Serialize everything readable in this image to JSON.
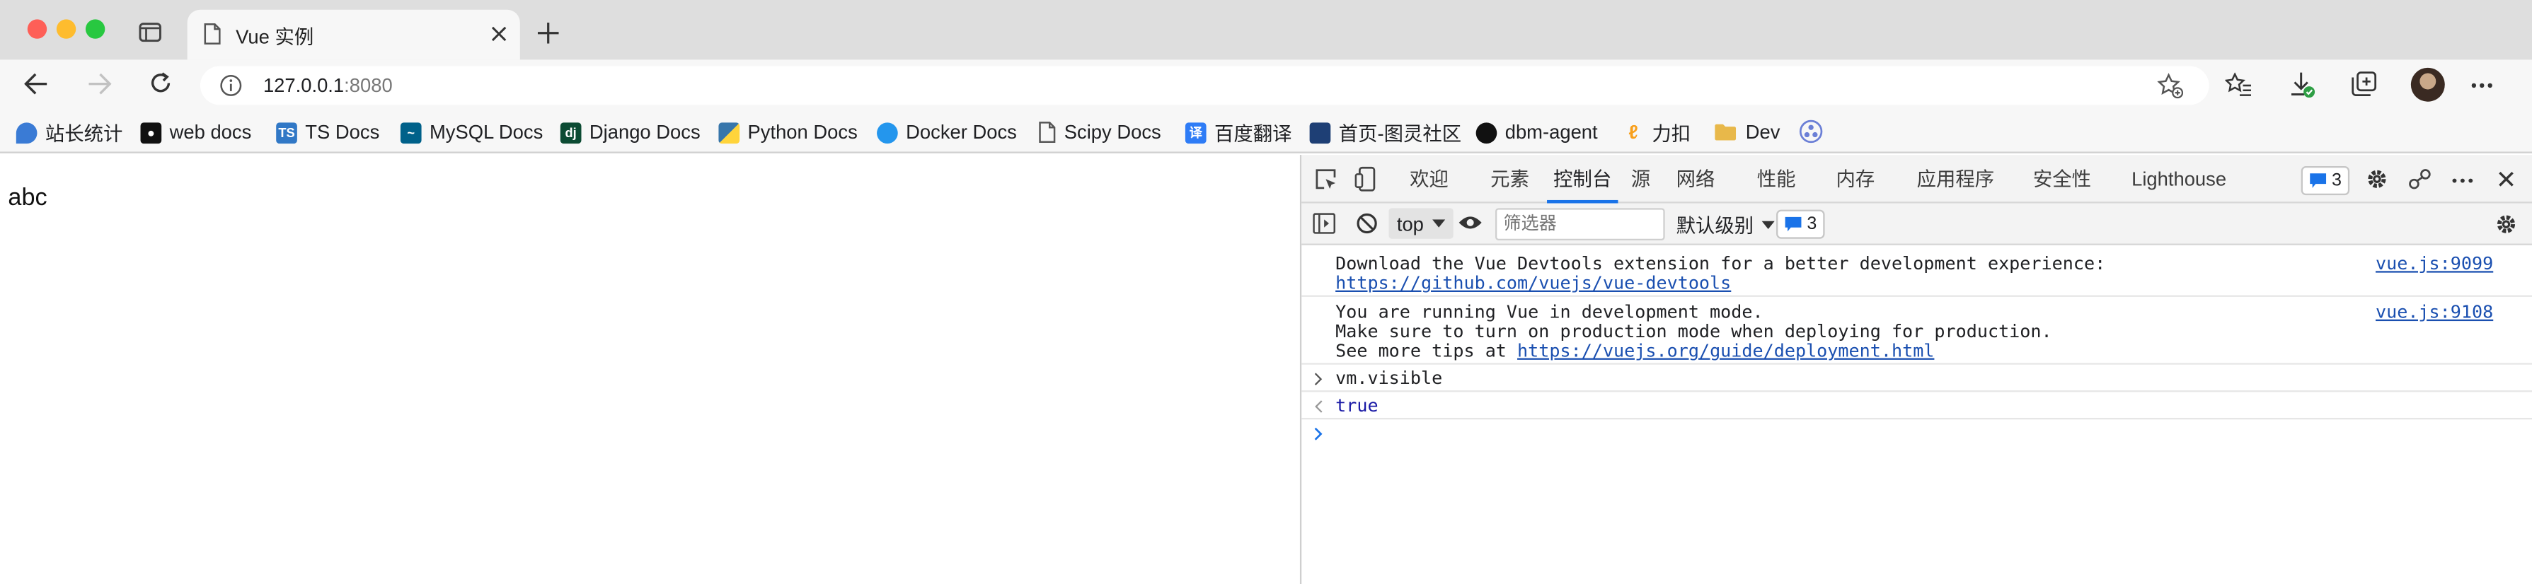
{
  "window": {
    "tab_title": "Vue 实例",
    "url_host": "127.0.0.1",
    "url_port": ":8080"
  },
  "bookmarks": [
    {
      "label": "站长统计",
      "icon": "stats-icon",
      "color": "#3a7bd5"
    },
    {
      "label": "web docs",
      "icon": "mdn-icon",
      "color": "#111111"
    },
    {
      "label": "TS Docs",
      "icon": "typescript-icon",
      "color": "#3178c6"
    },
    {
      "label": "MySQL Docs",
      "icon": "mysql-icon",
      "color": "#00618a"
    },
    {
      "label": "Django Docs",
      "icon": "django-icon",
      "color": "#0c4b33"
    },
    {
      "label": "Python Docs",
      "icon": "python-icon",
      "color": "#3776ab"
    },
    {
      "label": "Docker Docs",
      "icon": "docker-icon",
      "color": "#2496ed"
    },
    {
      "label": "Scipy Docs",
      "icon": "page-icon",
      "color": "#666666"
    },
    {
      "label": "百度翻译",
      "icon": "translate-icon",
      "color": "#2e7cf6"
    },
    {
      "label": "首页-图灵社区",
      "icon": "turing-icon",
      "color": "#1e3f75"
    },
    {
      "label": "dbm-agent",
      "icon": "github-icon",
      "color": "#111111"
    },
    {
      "label": "力扣",
      "icon": "leetcode-icon",
      "color": "#f89f1b"
    },
    {
      "label": "Dev",
      "icon": "folder-icon",
      "color": "#e8b84a"
    }
  ],
  "page": {
    "text": "abc"
  },
  "devtools": {
    "tabs": [
      "欢迎",
      "元素",
      "控制台",
      "源",
      "网络",
      "性能",
      "内存",
      "应用程序",
      "安全性",
      "Lighthouse"
    ],
    "active_tab": "控制台",
    "issues_count": "3",
    "context": "top",
    "filter_placeholder": "筛选器",
    "levels": "默认级别",
    "messages_count": "3",
    "messages": [
      {
        "lines": [
          "Download the Vue Devtools extension for a better development experience:"
        ],
        "link": "https://github.com/vuejs/vue-devtools",
        "source": "vue.js:9099"
      },
      {
        "lines": [
          "You are running Vue in development mode.",
          "Make sure to turn on production mode when deploying for production."
        ],
        "prefix": "See more tips at ",
        "link": "https://vuejs.org/guide/deployment.html",
        "source": "vue.js:9108"
      }
    ],
    "input": "vm.visible",
    "result": "true"
  },
  "colors": {
    "result_blue": "#1a1aa6",
    "link_blue": "#1a4fb0",
    "active_tab_underline": "#1a73e8"
  }
}
